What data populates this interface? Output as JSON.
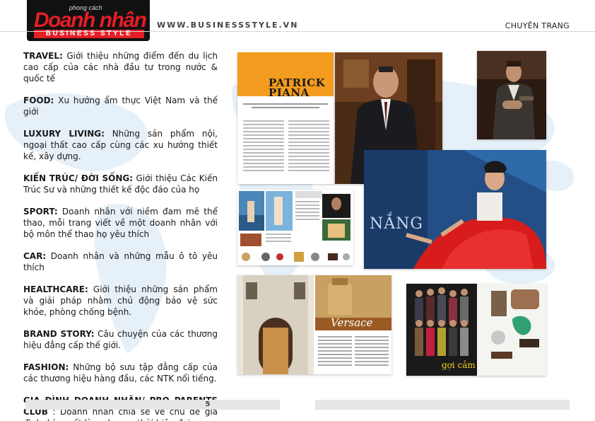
{
  "header": {
    "logo_top": "phong cách",
    "logo_main": "Doanh nhân",
    "logo_sub": "BUSINESS STYLE",
    "url": "WWW.BUSINESSSTYLE.VN",
    "section": "CHUYÊN TRANG"
  },
  "sections": [
    {
      "title": "TRAVEL:",
      "text": " Giới thiệu những điểm đến du lịch cao cấp của các nhà đầu tư trong nước & quốc tế"
    },
    {
      "title": "FOOD:",
      "text": " Xu hướng ẩm thực Việt Nam và thế giới"
    },
    {
      "title": "LUXURY LIVING:",
      "text": " Những sản phẩm nội, ngoại thất cao cấp cùng các xu hướng thiết kế, xây dựng."
    },
    {
      "title": "KIẾN TRÚC/ ĐỜI SỐNG:",
      "text": " Giới thiệu Các Kiến Trúc Sư và những thiết kế độc đáo của họ"
    },
    {
      "title": "SPORT:",
      "text": " Doanh nhân với niềm đam mê thể thao, mỗi trang viết về một doanh nhân với bộ môn thể thao họ yêu thích"
    },
    {
      "title": "CAR:",
      "text": " Doanh nhân và những mẫu ô tô yêu thích"
    },
    {
      "title": "HEALTHCARE:",
      "text": " Giới thiệu những sản phẩm và giải pháp nhằm chủ động bảo vệ sức khỏe, phòng chống bệnh."
    },
    {
      "title": "BRAND STORY:",
      "text": " Câu chuyện của các thương hiệu đẳng cấp thế giới."
    },
    {
      "title": "FASHION:",
      "text": " Những bộ sưu tập đẳng cấp của các thương hiệu hàng đầu, các NTK nổi tiếng."
    },
    {
      "title": "GIA ĐÌNH DOANH NHÂN/ PRO PARENTS CLUB",
      "text": " : Doanh nhân chia sẻ về chủ đề gia đình, bí quyết làm cha mẹ thời hiện đại,..."
    }
  ],
  "footer": {
    "page_number": "5"
  },
  "spreads": {
    "patrick": {
      "name_line1": "PATRICK",
      "name_line2": "PIANA"
    },
    "nang": {
      "title": "NẮNG"
    },
    "versace": {
      "title": "Versace"
    },
    "fashion": {
      "title": "gợi cảm"
    }
  },
  "colors": {
    "brand_red": "#e51d25",
    "accent_orange": "#f39c1f"
  }
}
